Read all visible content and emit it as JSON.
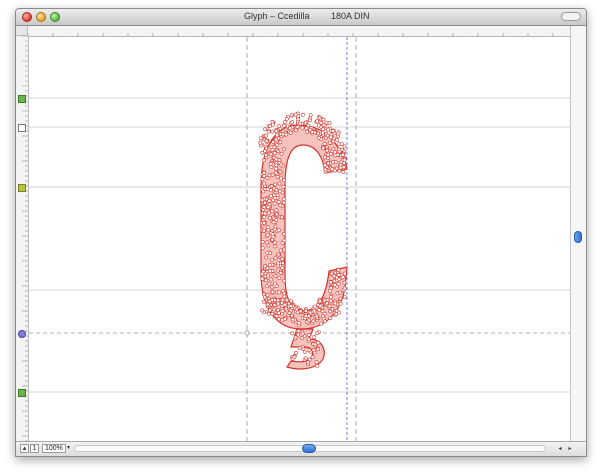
{
  "window": {
    "title": "Glyph – Ccedilla",
    "font_label": "180A DIN"
  },
  "toolbar": {
    "zoom_value": "100%",
    "zoom_caret": "▾",
    "left_btn_a": "▴",
    "left_btn_b": "1"
  },
  "colors": {
    "glyph_fill": "#f2a6a0",
    "glyph_stroke": "#d3352c",
    "guide": "#b0b0b0",
    "metric": "#5a5adf"
  },
  "icons": {
    "close": "close-icon",
    "minimize": "minimize-icon",
    "zoom": "zoom-window-icon",
    "toolbar_toggle": "toolbar-toggle-icon",
    "scroll_left": "scroll-left-icon",
    "scroll_right": "scroll-right-icon"
  }
}
